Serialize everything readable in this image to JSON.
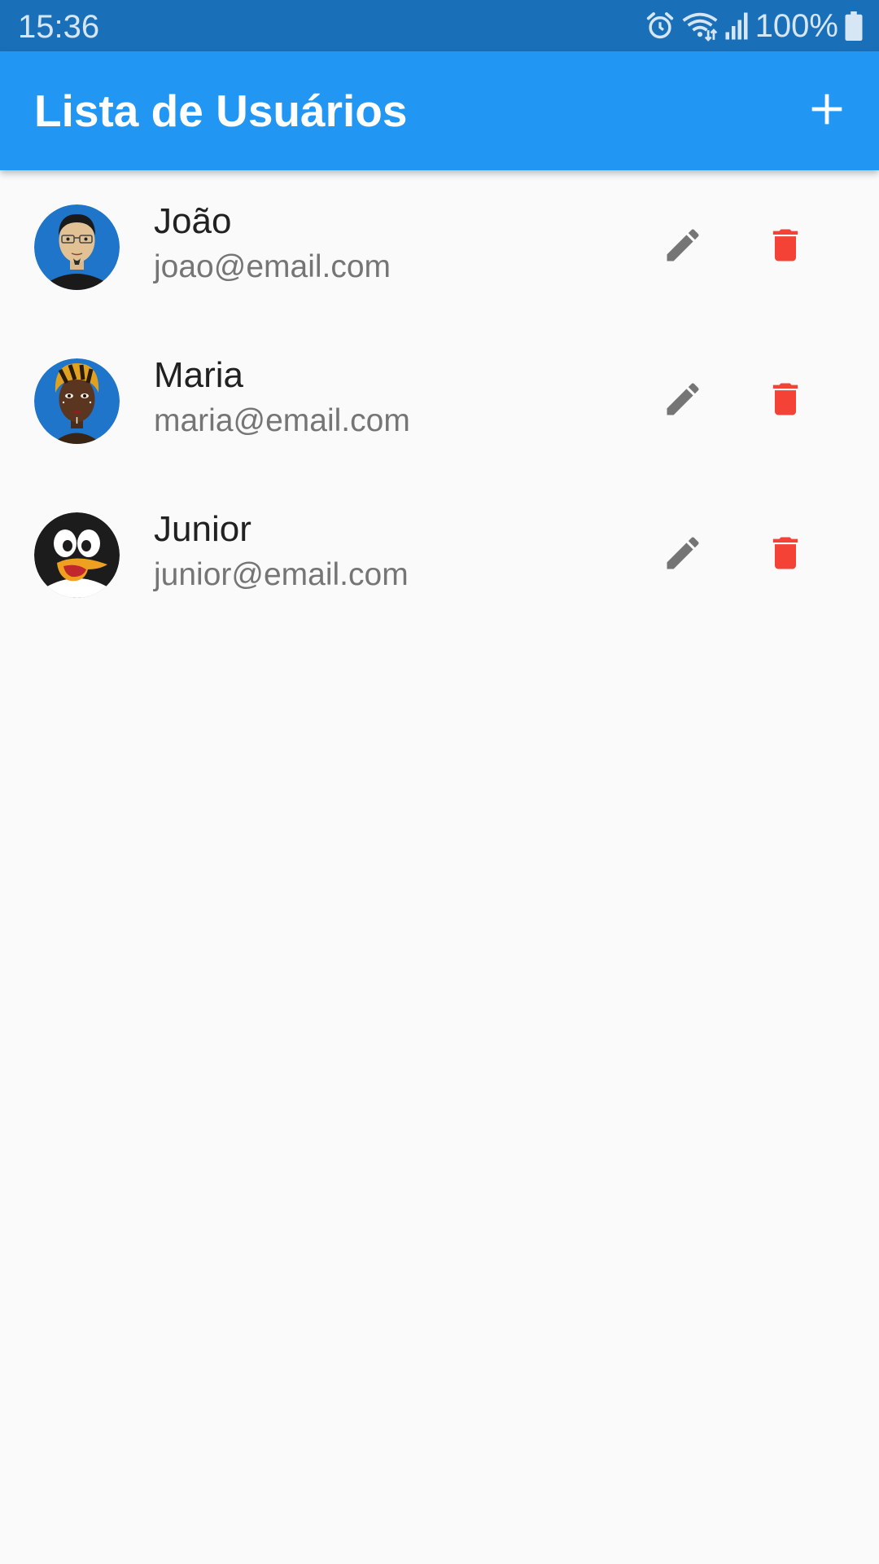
{
  "status_bar": {
    "time": "15:36",
    "battery": "100%",
    "icons": [
      "alarm-icon",
      "wifi-icon",
      "signal-icon",
      "battery-icon"
    ]
  },
  "app_bar": {
    "title": "Lista de Usuários",
    "add_icon": "plus-icon"
  },
  "users": [
    {
      "name": "João",
      "email": "joao@email.com",
      "avatar": "man-with-glasses-avatar"
    },
    {
      "name": "Maria",
      "email": "maria@email.com",
      "avatar": "woman-with-headwrap-avatar"
    },
    {
      "name": "Junior",
      "email": "junior@email.com",
      "avatar": "penguin-avatar"
    }
  ],
  "actions": {
    "edit_icon": "pencil-icon",
    "delete_icon": "trash-icon"
  },
  "colors": {
    "status_bar": "#1a70b8",
    "app_bar": "#2196f3",
    "background": "#fafafa",
    "edit_icon": "#757575",
    "delete_icon": "#f44336",
    "name_text": "#212121",
    "email_text": "#757575"
  }
}
